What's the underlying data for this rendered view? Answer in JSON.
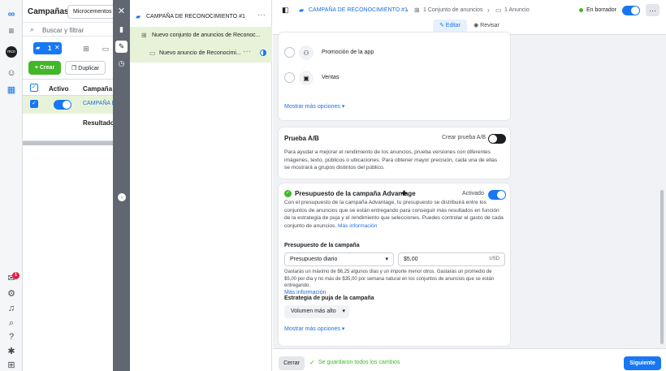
{
  "left": {
    "title": "Campañas",
    "account_select": "Microcementos D",
    "search_placeholder": "Buscar y filtrar",
    "selected_count": "1",
    "create": "Crear",
    "duplicate": "Duplicar",
    "col_active": "Activo",
    "col_campaign": "Campaña",
    "row_campaign": "CAMPAÑA D",
    "results_label": "Resultados"
  },
  "rail": {
    "notification_count": "1"
  },
  "tree": {
    "campaign": "CAMPAÑA DE RECONOCIMIENTO #1",
    "adset": "Nuevo conjunto de anuncios de Reconoc...",
    "ad": "Nuevo anuncio de Reconocimi..."
  },
  "header": {
    "crumb_campaign": "CAMPAÑA DE RECONOCIMIENTO #1",
    "crumb_adset": "1 Conjunto de anuncios",
    "crumb_ad": "1 Anuncio",
    "status": "En borrador",
    "edit": "Editar",
    "review": "Revisar"
  },
  "objectives": {
    "option1": "Promoción de la app",
    "option2": "Ventas",
    "more": "Mostrar más opciones"
  },
  "ab_test": {
    "title": "Prueba A/B",
    "toggle_label": "Crear prueba A/B",
    "description": "Para ayudar a mejorar el rendimiento de los anuncios, prueba versiones con diferentes imágenes, texto, públicos o ubicaciones. Para obtener mayor precisión, cada una de ellas se mostrará a grupos distintos del público."
  },
  "budget": {
    "title": "Presupuesto de la campaña Advantage",
    "title_suffix": "✚",
    "status": "Activado",
    "description": "Con el presupuesto de la campaña Advantage, tu presupuesto se distribuirá entre los conjuntos de anuncios que se están entregando para conseguir más resultados en función de la estrategia de puja y el rendimiento que selecciones. Puedes controlar el gasto de cada conjunto de anuncios.",
    "more_info": "Más información",
    "budget_label": "Presupuesto de la campaña",
    "budget_type": "Presupuesto diario",
    "amount": "$5,00",
    "currency": "USD",
    "note": "Gastarás un máximo de $6,25 algunos días y un importe menor otros. Gastarás un promedio de $5,00 por día y no más de $35,00 por semana natural en los conjuntos de anuncios que se están entregando.",
    "note_more_info": "Más información",
    "bid_label": "Estrategia de puja de la campaña",
    "bid_value": "Volumen más alto",
    "more": "Mostrar más opciones"
  },
  "footer": {
    "close": "Cerrar",
    "saved": "Se guardaron todos los cambios",
    "next": "Siguiente"
  },
  "colors": {
    "accent": "#1877f2",
    "green": "#42b72a",
    "dark_toolbar": "#606770"
  }
}
